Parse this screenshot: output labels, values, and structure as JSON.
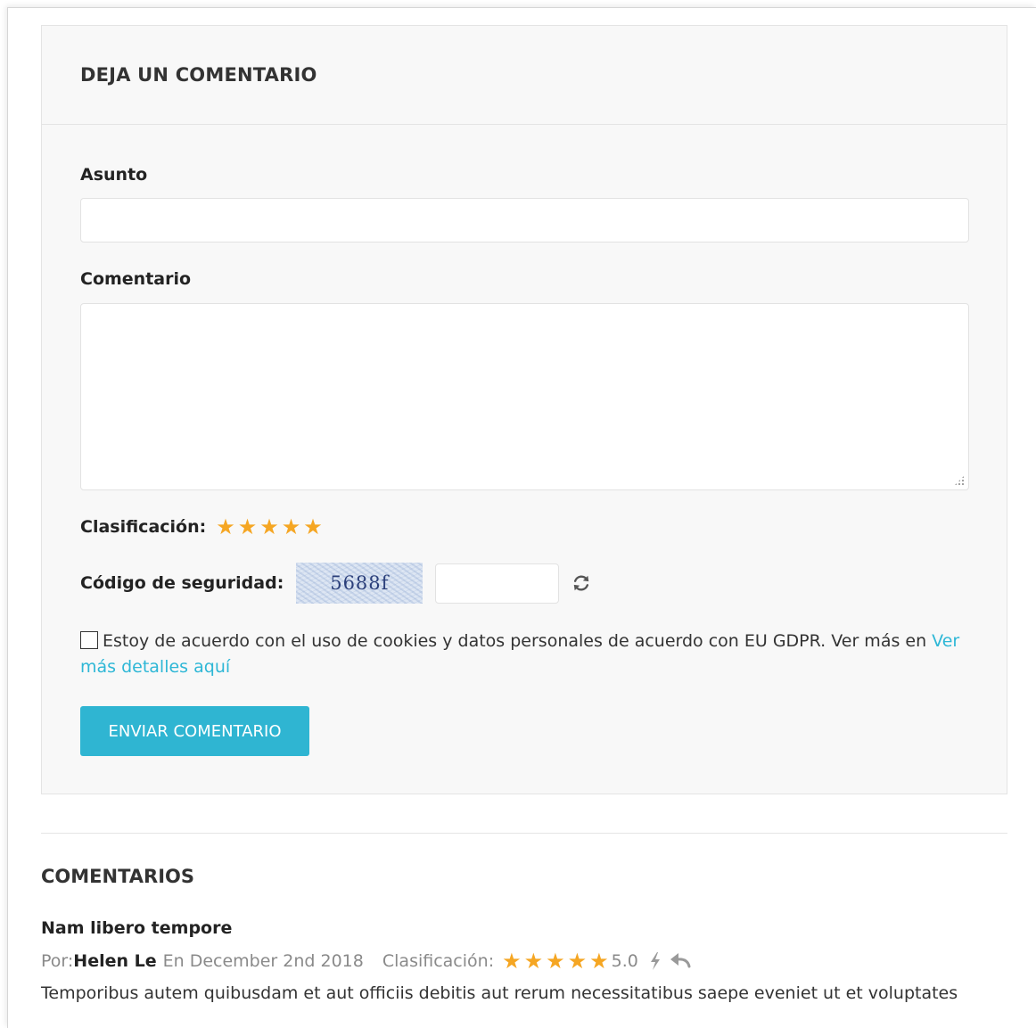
{
  "form": {
    "title": "DEJA UN COMENTARIO",
    "subject_label": "Asunto",
    "subject_value": "",
    "comment_label": "Comentario",
    "comment_value": "",
    "rating_label": "Clasificación:",
    "rating_value": 5,
    "rating_max": 5,
    "captcha_label": "Código de seguridad:",
    "captcha_text": "5688f",
    "captcha_input_value": "",
    "gdpr_text": "Estoy de acuerdo con el uso de cookies y datos personales de acuerdo con EU GDPR. Ver más en ",
    "gdpr_link": "Ver más detalles aquí",
    "gdpr_checked": false,
    "submit_label": "ENVIAR COMENTARIO"
  },
  "comments": {
    "title": "COMENTARIOS",
    "items": [
      {
        "subject": "Nam libero tempore",
        "by_label": "Por:",
        "author": "Helen Le",
        "date": "En December 2nd 2018",
        "rating_label": "Clasificación:",
        "rating_value": 5,
        "rating_text": "5.0",
        "body": "Temporibus autem quibusdam et aut officiis debitis aut rerum necessitatibus saepe eveniet ut et voluptates"
      }
    ]
  },
  "icons": {
    "star": "star-icon",
    "refresh": "refresh-icon",
    "reply": "reply-icon",
    "flag": "flash-icon"
  },
  "colors": {
    "accent": "#2fb5d2",
    "star": "#f5a623",
    "link": "#2eb7d6",
    "muted": "#8a8a8a"
  }
}
